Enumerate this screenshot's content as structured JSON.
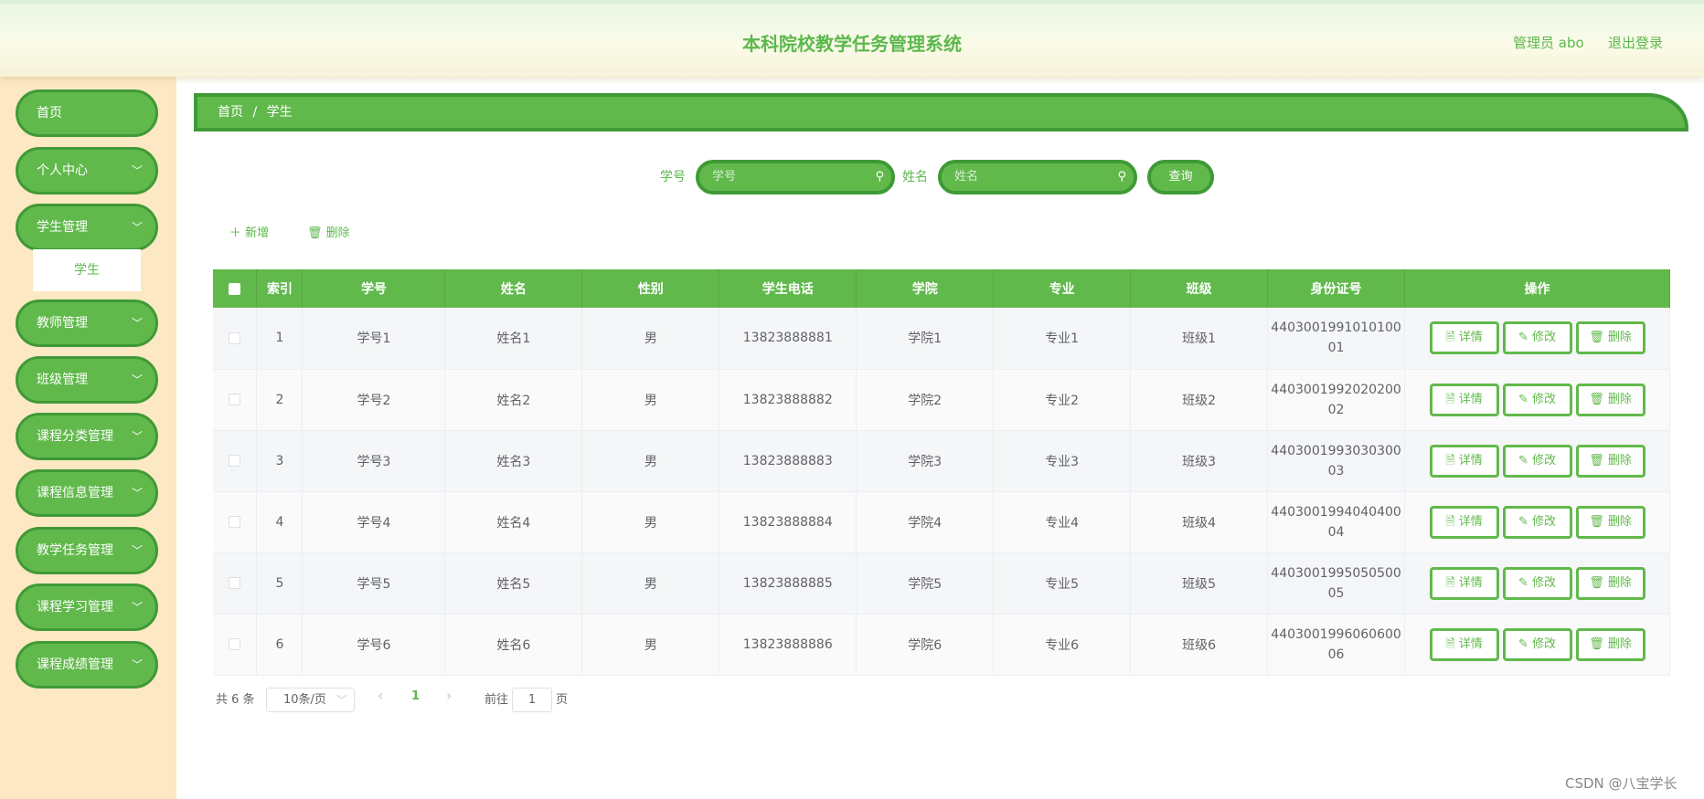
{
  "header": {
    "title": "本科院校教学任务管理系统",
    "admin": "管理员 abo",
    "logout": "退出登录"
  },
  "sidebar": {
    "items": [
      {
        "label": "首页",
        "chevron": false
      },
      {
        "label": "个人中心",
        "chevron": true
      },
      {
        "label": "学生管理",
        "chevron": true
      },
      {
        "label": "教师管理",
        "chevron": true
      },
      {
        "label": "班级管理",
        "chevron": true
      },
      {
        "label": "课程分类管理",
        "chevron": true
      },
      {
        "label": "课程信息管理",
        "chevron": true
      },
      {
        "label": "教学任务管理",
        "chevron": true
      },
      {
        "label": "课程学习管理",
        "chevron": true
      },
      {
        "label": "课程成绩管理",
        "chevron": true
      }
    ],
    "subitem": "学生",
    "chevron_glyph": "﹀"
  },
  "breadcrumb": {
    "home": "首页",
    "sep": "/",
    "current": "学生"
  },
  "search": {
    "student_id_label": "学号",
    "student_id_placeholder": "学号",
    "name_label": "姓名",
    "name_placeholder": "姓名",
    "query_label": "查询"
  },
  "toolbar": {
    "add_label": "＋ 新增",
    "delete_label": "🗑 删除"
  },
  "table": {
    "headers": [
      "",
      "索引",
      "学号",
      "姓名",
      "性别",
      "学生电话",
      "学院",
      "专业",
      "班级",
      "身份证号",
      "操作"
    ],
    "rows": [
      {
        "index": "1",
        "sid": "学号1",
        "name": "姓名1",
        "gender": "男",
        "phone": "13823888881",
        "college": "学院1",
        "major": "专业1",
        "class": "班级1",
        "id_line1": "4403001991010100",
        "id_line2": "01"
      },
      {
        "index": "2",
        "sid": "学号2",
        "name": "姓名2",
        "gender": "男",
        "phone": "13823888882",
        "college": "学院2",
        "major": "专业2",
        "class": "班级2",
        "id_line1": "4403001992020200",
        "id_line2": "02"
      },
      {
        "index": "3",
        "sid": "学号3",
        "name": "姓名3",
        "gender": "男",
        "phone": "13823888883",
        "college": "学院3",
        "major": "专业3",
        "class": "班级3",
        "id_line1": "4403001993030300",
        "id_line2": "03"
      },
      {
        "index": "4",
        "sid": "学号4",
        "name": "姓名4",
        "gender": "男",
        "phone": "13823888884",
        "college": "学院4",
        "major": "专业4",
        "class": "班级4",
        "id_line1": "4403001994040400",
        "id_line2": "04"
      },
      {
        "index": "5",
        "sid": "学号5",
        "name": "姓名5",
        "gender": "男",
        "phone": "13823888885",
        "college": "学院5",
        "major": "专业5",
        "class": "班级5",
        "id_line1": "4403001995050500",
        "id_line2": "05"
      },
      {
        "index": "6",
        "sid": "学号6",
        "name": "姓名6",
        "gender": "男",
        "phone": "13823888886",
        "college": "学院6",
        "major": "专业6",
        "class": "班级6",
        "id_line1": "4403001996060600",
        "id_line2": "06"
      }
    ],
    "ops": {
      "detail": "🗎 详情",
      "edit": "✎ 修改",
      "delete": "🗑 删除"
    }
  },
  "pagination": {
    "total": "共 6 条",
    "page_size": "10条/页",
    "prev": "‹",
    "current_page": "1",
    "next": "›",
    "goto_label": "前往",
    "goto_value": "1",
    "page_unit": "页"
  },
  "watermark": "CSDN @八宝学长",
  "colors": {
    "accent": "#61b94c",
    "accent_dark": "#3f9a36",
    "sidebar_bg": "#fde8c4"
  }
}
